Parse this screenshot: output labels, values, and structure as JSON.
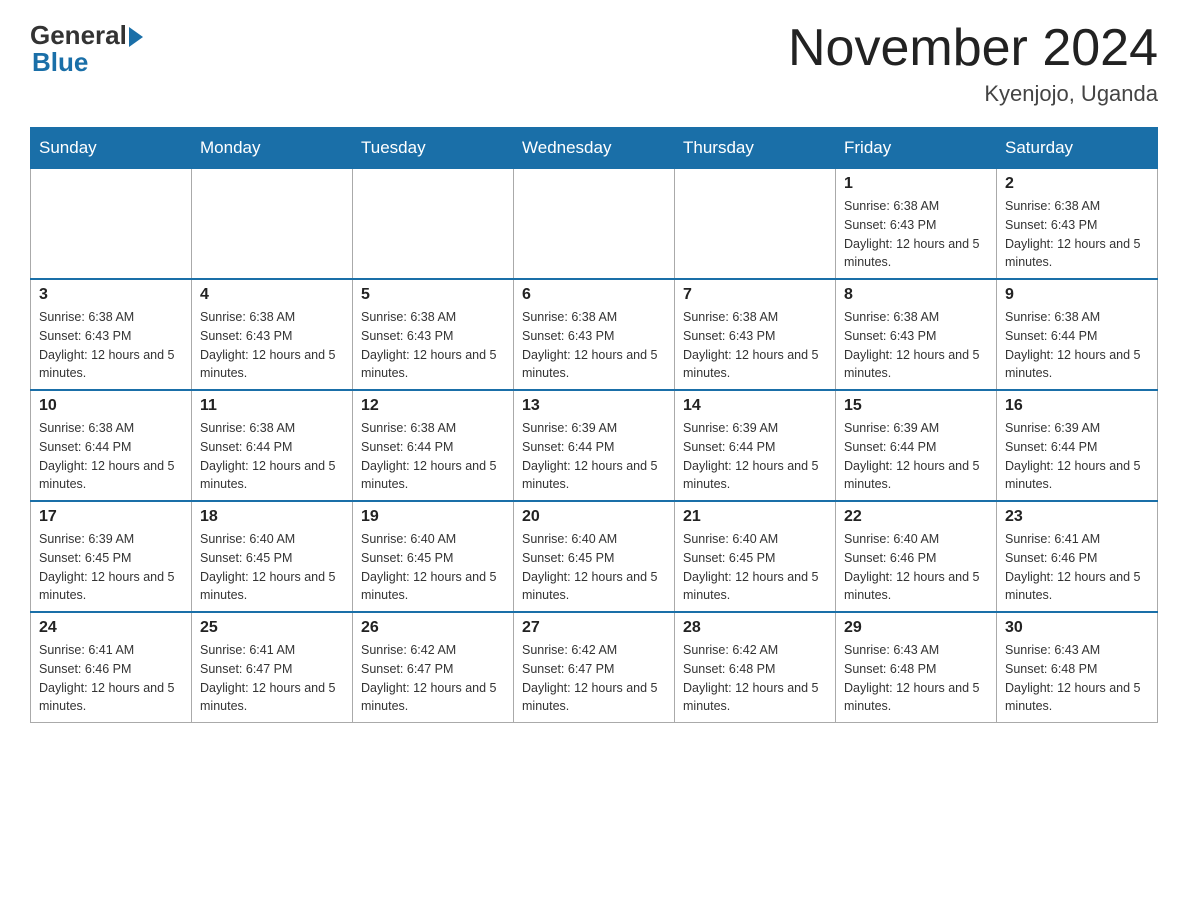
{
  "header": {
    "logo_general": "General",
    "logo_blue": "Blue",
    "month_title": "November 2024",
    "location": "Kyenjojo, Uganda"
  },
  "days_of_week": [
    "Sunday",
    "Monday",
    "Tuesday",
    "Wednesday",
    "Thursday",
    "Friday",
    "Saturday"
  ],
  "weeks": [
    [
      {
        "day": "",
        "info": ""
      },
      {
        "day": "",
        "info": ""
      },
      {
        "day": "",
        "info": ""
      },
      {
        "day": "",
        "info": ""
      },
      {
        "day": "",
        "info": ""
      },
      {
        "day": "1",
        "info": "Sunrise: 6:38 AM\nSunset: 6:43 PM\nDaylight: 12 hours and 5 minutes."
      },
      {
        "day": "2",
        "info": "Sunrise: 6:38 AM\nSunset: 6:43 PM\nDaylight: 12 hours and 5 minutes."
      }
    ],
    [
      {
        "day": "3",
        "info": "Sunrise: 6:38 AM\nSunset: 6:43 PM\nDaylight: 12 hours and 5 minutes."
      },
      {
        "day": "4",
        "info": "Sunrise: 6:38 AM\nSunset: 6:43 PM\nDaylight: 12 hours and 5 minutes."
      },
      {
        "day": "5",
        "info": "Sunrise: 6:38 AM\nSunset: 6:43 PM\nDaylight: 12 hours and 5 minutes."
      },
      {
        "day": "6",
        "info": "Sunrise: 6:38 AM\nSunset: 6:43 PM\nDaylight: 12 hours and 5 minutes."
      },
      {
        "day": "7",
        "info": "Sunrise: 6:38 AM\nSunset: 6:43 PM\nDaylight: 12 hours and 5 minutes."
      },
      {
        "day": "8",
        "info": "Sunrise: 6:38 AM\nSunset: 6:43 PM\nDaylight: 12 hours and 5 minutes."
      },
      {
        "day": "9",
        "info": "Sunrise: 6:38 AM\nSunset: 6:44 PM\nDaylight: 12 hours and 5 minutes."
      }
    ],
    [
      {
        "day": "10",
        "info": "Sunrise: 6:38 AM\nSunset: 6:44 PM\nDaylight: 12 hours and 5 minutes."
      },
      {
        "day": "11",
        "info": "Sunrise: 6:38 AM\nSunset: 6:44 PM\nDaylight: 12 hours and 5 minutes."
      },
      {
        "day": "12",
        "info": "Sunrise: 6:38 AM\nSunset: 6:44 PM\nDaylight: 12 hours and 5 minutes."
      },
      {
        "day": "13",
        "info": "Sunrise: 6:39 AM\nSunset: 6:44 PM\nDaylight: 12 hours and 5 minutes."
      },
      {
        "day": "14",
        "info": "Sunrise: 6:39 AM\nSunset: 6:44 PM\nDaylight: 12 hours and 5 minutes."
      },
      {
        "day": "15",
        "info": "Sunrise: 6:39 AM\nSunset: 6:44 PM\nDaylight: 12 hours and 5 minutes."
      },
      {
        "day": "16",
        "info": "Sunrise: 6:39 AM\nSunset: 6:44 PM\nDaylight: 12 hours and 5 minutes."
      }
    ],
    [
      {
        "day": "17",
        "info": "Sunrise: 6:39 AM\nSunset: 6:45 PM\nDaylight: 12 hours and 5 minutes."
      },
      {
        "day": "18",
        "info": "Sunrise: 6:40 AM\nSunset: 6:45 PM\nDaylight: 12 hours and 5 minutes."
      },
      {
        "day": "19",
        "info": "Sunrise: 6:40 AM\nSunset: 6:45 PM\nDaylight: 12 hours and 5 minutes."
      },
      {
        "day": "20",
        "info": "Sunrise: 6:40 AM\nSunset: 6:45 PM\nDaylight: 12 hours and 5 minutes."
      },
      {
        "day": "21",
        "info": "Sunrise: 6:40 AM\nSunset: 6:45 PM\nDaylight: 12 hours and 5 minutes."
      },
      {
        "day": "22",
        "info": "Sunrise: 6:40 AM\nSunset: 6:46 PM\nDaylight: 12 hours and 5 minutes."
      },
      {
        "day": "23",
        "info": "Sunrise: 6:41 AM\nSunset: 6:46 PM\nDaylight: 12 hours and 5 minutes."
      }
    ],
    [
      {
        "day": "24",
        "info": "Sunrise: 6:41 AM\nSunset: 6:46 PM\nDaylight: 12 hours and 5 minutes."
      },
      {
        "day": "25",
        "info": "Sunrise: 6:41 AM\nSunset: 6:47 PM\nDaylight: 12 hours and 5 minutes."
      },
      {
        "day": "26",
        "info": "Sunrise: 6:42 AM\nSunset: 6:47 PM\nDaylight: 12 hours and 5 minutes."
      },
      {
        "day": "27",
        "info": "Sunrise: 6:42 AM\nSunset: 6:47 PM\nDaylight: 12 hours and 5 minutes."
      },
      {
        "day": "28",
        "info": "Sunrise: 6:42 AM\nSunset: 6:48 PM\nDaylight: 12 hours and 5 minutes."
      },
      {
        "day": "29",
        "info": "Sunrise: 6:43 AM\nSunset: 6:48 PM\nDaylight: 12 hours and 5 minutes."
      },
      {
        "day": "30",
        "info": "Sunrise: 6:43 AM\nSunset: 6:48 PM\nDaylight: 12 hours and 5 minutes."
      }
    ]
  ]
}
